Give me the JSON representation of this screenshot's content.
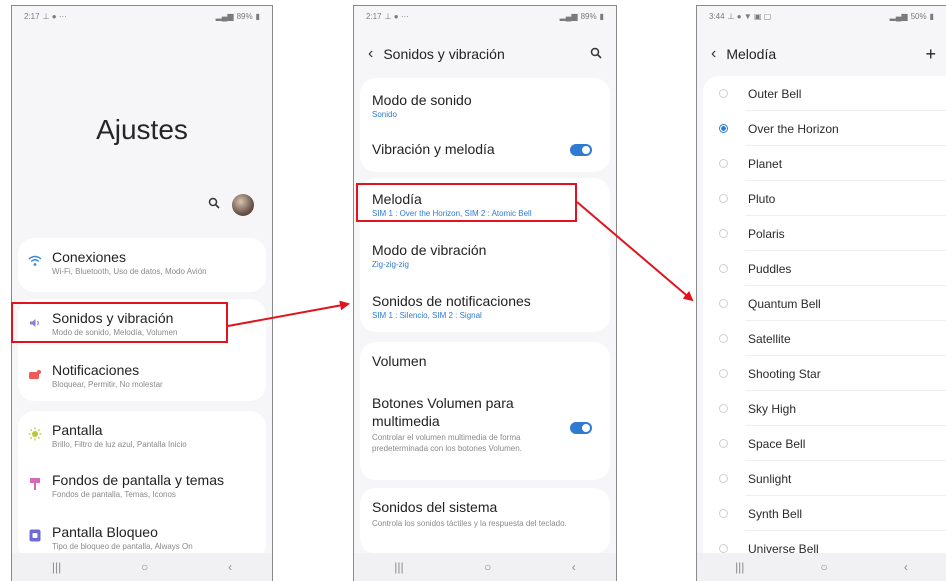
{
  "phone1": {
    "status": {
      "time": "2:17",
      "battery": "89%"
    },
    "title": "Ajustes",
    "rows": [
      {
        "title": "Conexiones",
        "sub": "Wi-Fi, Bluetooth, Uso de datos, Modo Avión"
      },
      {
        "title": "Sonidos y vibración",
        "sub": "Modo de sonido, Melodía, Volumen"
      },
      {
        "title": "Notificaciones",
        "sub": "Bloquear, Permitir, No molestar"
      },
      {
        "title": "Pantalla",
        "sub": "Brillo, Filtro de luz azul, Pantalla Inicio"
      },
      {
        "title": "Fondos de pantalla y temas",
        "sub": "Fondos de pantalla, Temas, Iconos"
      },
      {
        "title": "Pantalla Bloqueo",
        "sub": "Tipo de bloqueo de pantalla, Always On"
      }
    ]
  },
  "phone2": {
    "status": {
      "time": "2:17",
      "battery": "89%"
    },
    "header": "Sonidos y vibración",
    "items": [
      {
        "title": "Modo de sonido",
        "sub": "Sonido"
      },
      {
        "title": "Vibración y melodía",
        "toggle": true
      },
      {
        "title": "Melodía",
        "sub": "SIM 1 : Over the Horizon, SIM 2 : Atomic Bell"
      },
      {
        "title": "Modo de vibración",
        "sub": "Zig-zig-zig"
      },
      {
        "title": "Sonidos de notificaciones",
        "sub": "SIM 1 : Silencio, SIM 2 : Signal"
      },
      {
        "title": "Volumen"
      },
      {
        "title": "Botones Volumen para multimedia",
        "sub": "Controlar el volumen multimedia de forma predeterminada con los botones Volumen.",
        "toggle": true
      },
      {
        "title": "Sonidos del sistema",
        "sub": "Controla los sonidos táctiles y la respuesta del teclado."
      }
    ]
  },
  "phone3": {
    "status": {
      "time": "3:44",
      "battery": "50%"
    },
    "header": "Melodía",
    "add": "+",
    "selected_index": 1,
    "ringtones": [
      "Outer Bell",
      "Over the Horizon",
      "Planet",
      "Pluto",
      "Polaris",
      "Puddles",
      "Quantum Bell",
      "Satellite",
      "Shooting Star",
      "Sky High",
      "Space Bell",
      "Sunlight",
      "Synth Bell",
      "Universe Bell"
    ]
  },
  "colors": {
    "accent": "#2f7bd1",
    "highlight": "#e0141e"
  },
  "icons": [
    "wifi-icon",
    "sound-icon",
    "notification-icon",
    "brightness-icon",
    "brush-icon",
    "lock-icon",
    "search-icon",
    "back-icon",
    "plus-icon"
  ]
}
